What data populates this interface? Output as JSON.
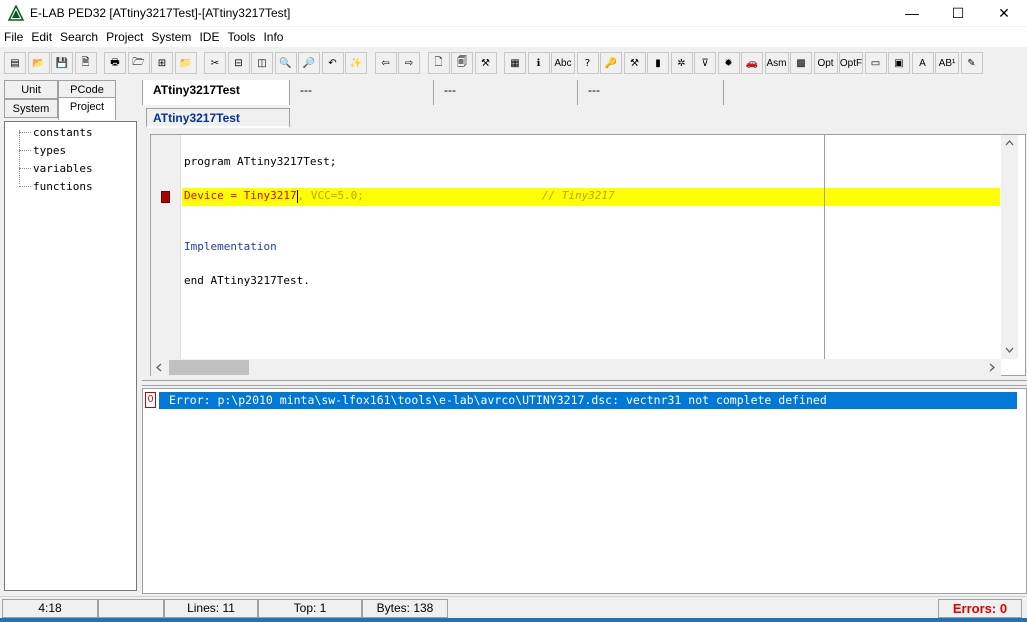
{
  "window": {
    "title": "E-LAB PED32 [ATtiny3217Test]-[ATtiny3217Test]",
    "minimize": "—",
    "maximize": "☐",
    "close": "✕"
  },
  "menu": [
    "File",
    "Edit",
    "Search",
    "Project",
    "System",
    "IDE",
    "Tools",
    "Info"
  ],
  "toolbar": {
    "buttons": [
      {
        "name": "new-files-button",
        "glyph": "▤"
      },
      {
        "name": "open-folder-button",
        "glyph": "📂"
      },
      {
        "name": "save-button",
        "glyph": "💾"
      },
      {
        "name": "save-all-button",
        "glyph": "🗎"
      },
      {
        "name": "print-button",
        "glyph": "🖶"
      },
      {
        "name": "open-project-button",
        "glyph": "🗁"
      },
      {
        "name": "add-file-button",
        "glyph": "⊞"
      },
      {
        "name": "project-folder-button",
        "glyph": "📁"
      },
      {
        "name": "cut-button",
        "glyph": "✂"
      },
      {
        "name": "split-horizontal-button",
        "glyph": "⊟"
      },
      {
        "name": "split-vertical-button",
        "glyph": "◫"
      },
      {
        "name": "find-button",
        "glyph": "🔍"
      },
      {
        "name": "replace-button",
        "glyph": "🔎"
      },
      {
        "name": "undo-button",
        "glyph": "↶"
      },
      {
        "name": "magic-wand-button",
        "glyph": "✨"
      },
      {
        "name": "back-button",
        "glyph": "⇦"
      },
      {
        "name": "forward-button",
        "glyph": "⇨"
      },
      {
        "name": "preview-button",
        "glyph": "🗋"
      },
      {
        "name": "document-button",
        "glyph": "🗐"
      },
      {
        "name": "tools-button",
        "glyph": "⚒"
      },
      {
        "name": "calculator-button",
        "glyph": "▦"
      },
      {
        "name": "hint-button",
        "glyph": "ℹ"
      },
      {
        "name": "spellcheck-button",
        "glyph": "Abc"
      },
      {
        "name": "help-button",
        "glyph": "?"
      },
      {
        "name": "key-help-button",
        "glyph": "🔑"
      },
      {
        "name": "build-button",
        "glyph": "⚒"
      },
      {
        "name": "chart-button",
        "glyph": "▮"
      },
      {
        "name": "tree-button",
        "glyph": "✲"
      },
      {
        "name": "filter-button",
        "glyph": "⊽"
      },
      {
        "name": "debug-button",
        "glyph": "✹"
      },
      {
        "name": "car-button",
        "glyph": "🚗"
      },
      {
        "name": "asm-button",
        "glyph": "Asm"
      },
      {
        "name": "chip-button",
        "glyph": "▩"
      },
      {
        "name": "opt-button",
        "glyph": "Opt"
      },
      {
        "name": "optf-button",
        "glyph": "OptF"
      },
      {
        "name": "serial-button",
        "glyph": "▭"
      },
      {
        "name": "board-button",
        "glyph": "▣"
      },
      {
        "name": "font-button",
        "glyph": "A"
      },
      {
        "name": "superscript-button",
        "glyph": "AB¹"
      },
      {
        "name": "pen-button",
        "glyph": "✎"
      }
    ]
  },
  "left": {
    "tabs": [
      "Unit",
      "PCode",
      "System",
      "Project"
    ],
    "tree": [
      "constants",
      "types",
      "variables",
      "functions"
    ]
  },
  "editor_tabs": [
    "ATtiny3217Test",
    "---",
    "---",
    "---"
  ],
  "subtab": "ATtiny3217Test",
  "code": {
    "line1": "program ATtiny3217Test;",
    "line2a": "Device = Tiny3217",
    "line2b": ", VCC=5.0;",
    "line2c": "// Tiny3217",
    "line3": "Implementation",
    "line4": "end ATtiny3217Test."
  },
  "messages": {
    "number": "0",
    "text": "Error: p:\\p2010 minta\\sw-lfox161\\tools\\e-lab\\avrco\\UTINY3217.dsc: vectnr31 not complete defined"
  },
  "status": {
    "position": "4:18",
    "lines": "Lines: 11",
    "top": "Top: 1",
    "bytes": "Bytes: 138",
    "errors": "Errors: 0"
  },
  "scroll": {
    "left": "<",
    "right": ">",
    "up": "^",
    "down": "v"
  }
}
